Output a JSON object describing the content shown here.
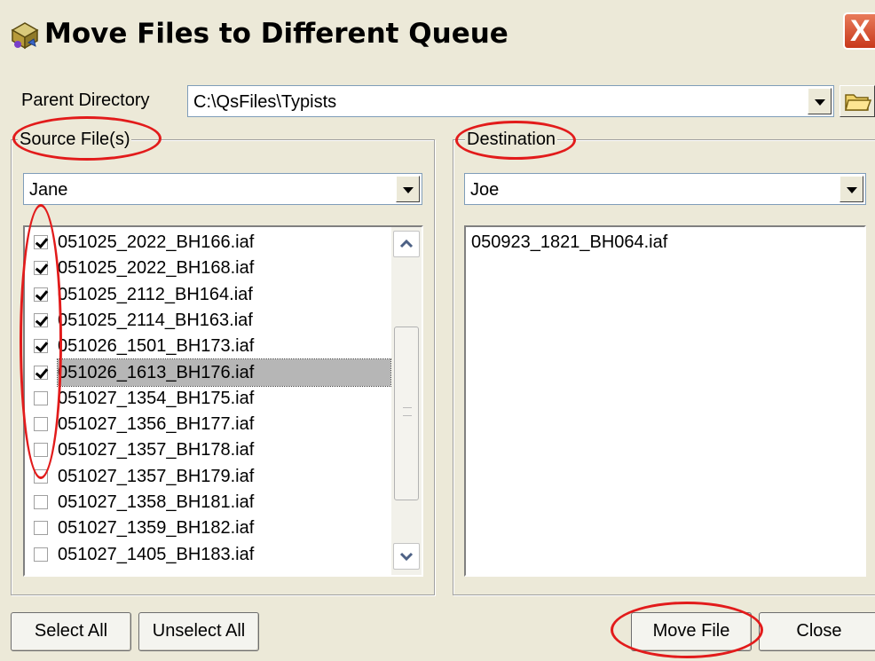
{
  "window": {
    "title": "Move Files to Different Queue",
    "close_label": "X"
  },
  "parent_directory": {
    "label": "Parent Directory",
    "value": "C:\\QsFiles\\Typists"
  },
  "source": {
    "legend": "Source File(s)",
    "selected_queue": "Jane",
    "files": [
      {
        "name": "051025_2022_BH166.iaf",
        "checked": true
      },
      {
        "name": "051025_2022_BH168.iaf",
        "checked": true
      },
      {
        "name": "051025_2112_BH164.iaf",
        "checked": true
      },
      {
        "name": "051025_2114_BH163.iaf",
        "checked": true
      },
      {
        "name": "051026_1501_BH173.iaf",
        "checked": true
      },
      {
        "name": "051026_1613_BH176.iaf",
        "checked": true,
        "selected": true
      },
      {
        "name": "051027_1354_BH175.iaf",
        "checked": false
      },
      {
        "name": "051027_1356_BH177.iaf",
        "checked": false
      },
      {
        "name": "051027_1357_BH178.iaf",
        "checked": false
      },
      {
        "name": "051027_1357_BH179.iaf",
        "checked": false
      },
      {
        "name": "051027_1358_BH181.iaf",
        "checked": false
      },
      {
        "name": "051027_1359_BH182.iaf",
        "checked": false
      },
      {
        "name": "051027_1405_BH183.iaf",
        "checked": false
      }
    ]
  },
  "destination": {
    "legend": "Destination",
    "selected_queue": "Joe",
    "files": [
      "050923_1821_BH064.iaf"
    ]
  },
  "buttons": {
    "select_all": "Select All",
    "unselect_all": "Unselect All",
    "move_file": "Move File",
    "close": "Close"
  },
  "colors": {
    "annotation": "#e21b1b",
    "dialog_bg": "#ece9d8",
    "selection": "#b6b6b6"
  }
}
